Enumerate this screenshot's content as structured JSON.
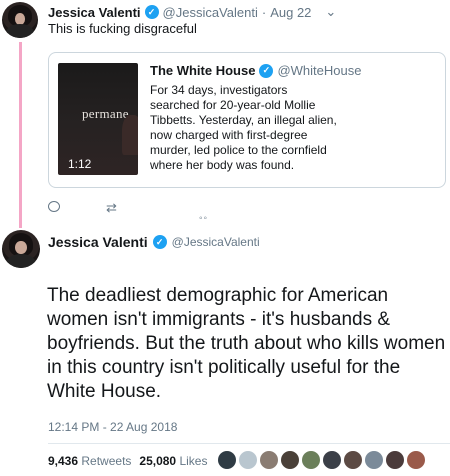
{
  "tweet1": {
    "name": "Jessica Valenti",
    "handle": "@JessicaValenti",
    "separator": "·",
    "date": "Aug 22",
    "text": "This is fucking disgraceful",
    "quote": {
      "name": "The White House",
      "handle": "@WhiteHouse",
      "text": "For 34 days, investigators searched for 20-year-old Mollie Tibbetts. Yesterday, an illegal alien, now charged with first-degree murder, led police to the cornfield where her body was found.",
      "video_word": "permane",
      "video_duration": "1:12"
    }
  },
  "tweet2": {
    "name": "Jessica Valenti",
    "handle": "@JessicaValenti",
    "text": "The deadliest demographic for American women isn't immigrants - it's husbands & boyfriends. But the truth about who kills women in this country isn't politically useful for the White House.",
    "timestamp": "12:14 PM - 22 Aug 2018",
    "retweets_count": "9,436",
    "retweets_label": "Retweets",
    "likes_count": "25,080",
    "likes_label": "Likes"
  },
  "colors": {
    "accent": "#1da1f2",
    "thread_line": "#f4a6c6",
    "muted": "#657786"
  },
  "liker_colors": [
    "#2f3b44",
    "#b9c6cf",
    "#8a7c72",
    "#4a4038",
    "#6b7f5a",
    "#3b3f47",
    "#5c4a44",
    "#7b8a99",
    "#4b3b3b",
    "#9a5a4a"
  ]
}
